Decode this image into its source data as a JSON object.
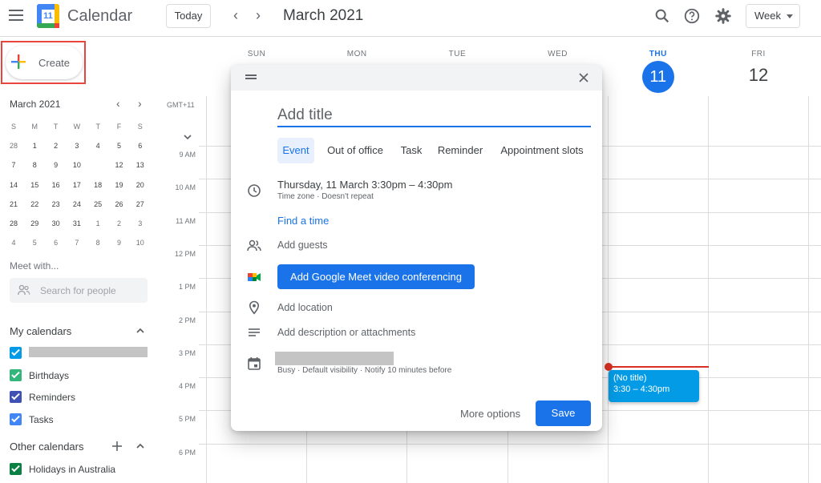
{
  "header": {
    "app_title": "Calendar",
    "logo_day": "11",
    "today_label": "Today",
    "prev_icon": "‹",
    "next_icon": "›",
    "date_title": "March 2021",
    "view_label": "Week",
    "icons": [
      "menu-icon",
      "search-icon",
      "help-icon",
      "settings-icon"
    ]
  },
  "sidebar": {
    "create_label": "Create",
    "mini_calendar": {
      "title": "March 2021",
      "weekday_heads": [
        "S",
        "M",
        "T",
        "W",
        "T",
        "F",
        "S"
      ],
      "weeks": [
        [
          "28",
          "1",
          "2",
          "3",
          "4",
          "5",
          "6"
        ],
        [
          "7",
          "8",
          "9",
          "10",
          "11",
          "12",
          "13"
        ],
        [
          "14",
          "15",
          "16",
          "17",
          "18",
          "19",
          "20"
        ],
        [
          "21",
          "22",
          "23",
          "24",
          "25",
          "26",
          "27"
        ],
        [
          "28",
          "29",
          "30",
          "31",
          "1",
          "2",
          "3"
        ],
        [
          "4",
          "5",
          "6",
          "7",
          "8",
          "9",
          "10"
        ]
      ],
      "today": "11"
    },
    "meet_with": "Meet with...",
    "search_placeholder": "Search for people",
    "my_calendars_title": "My calendars",
    "my_calendars": [
      {
        "label": "",
        "color": "#039be5"
      },
      {
        "label": "Birthdays",
        "color": "#33b679"
      },
      {
        "label": "Reminders",
        "color": "#3f51b5"
      },
      {
        "label": "Tasks",
        "color": "#4285f4"
      }
    ],
    "other_calendars_title": "Other calendars",
    "other_calendars": [
      {
        "label": "Holidays in Australia",
        "color": "#0b8043"
      }
    ]
  },
  "week": {
    "days": [
      {
        "dow": "SUN",
        "num": ""
      },
      {
        "dow": "MON",
        "num": ""
      },
      {
        "dow": "TUE",
        "num": ""
      },
      {
        "dow": "WED",
        "num": ""
      },
      {
        "dow": "THU",
        "num": "11",
        "today": true
      },
      {
        "dow": "FRI",
        "num": "12"
      }
    ],
    "timezone": "GMT+11",
    "hours": [
      "9 AM",
      "10 AM",
      "11 AM",
      "12 PM",
      "1 PM",
      "2 PM",
      "3 PM",
      "4 PM",
      "5 PM",
      "6 PM"
    ],
    "event": {
      "title": "(No title)",
      "time": "3:30 – 4:30pm"
    }
  },
  "dialog": {
    "title_placeholder": "Add title",
    "tabs": [
      "Event",
      "Out of office",
      "Task",
      "Reminder",
      "Appointment slots"
    ],
    "active_tab": "Event",
    "datetime": "Thursday, 11 March   3:30pm  –  4:30pm",
    "datetime_sub": "Time zone · Doesn't repeat",
    "find_time": "Find a time",
    "add_guests": "Add guests",
    "meet_button": "Add Google Meet video conferencing",
    "add_location": "Add location",
    "add_description": "Add description or attachments",
    "calendar_sub": "Busy · Default visibility · Notify 10 minutes before",
    "more_options": "More options",
    "save": "Save"
  },
  "colors": {
    "accent": "#1a73e8",
    "event": "#039be5",
    "now_line": "#d93025",
    "highlight_border": "#e8453c"
  }
}
